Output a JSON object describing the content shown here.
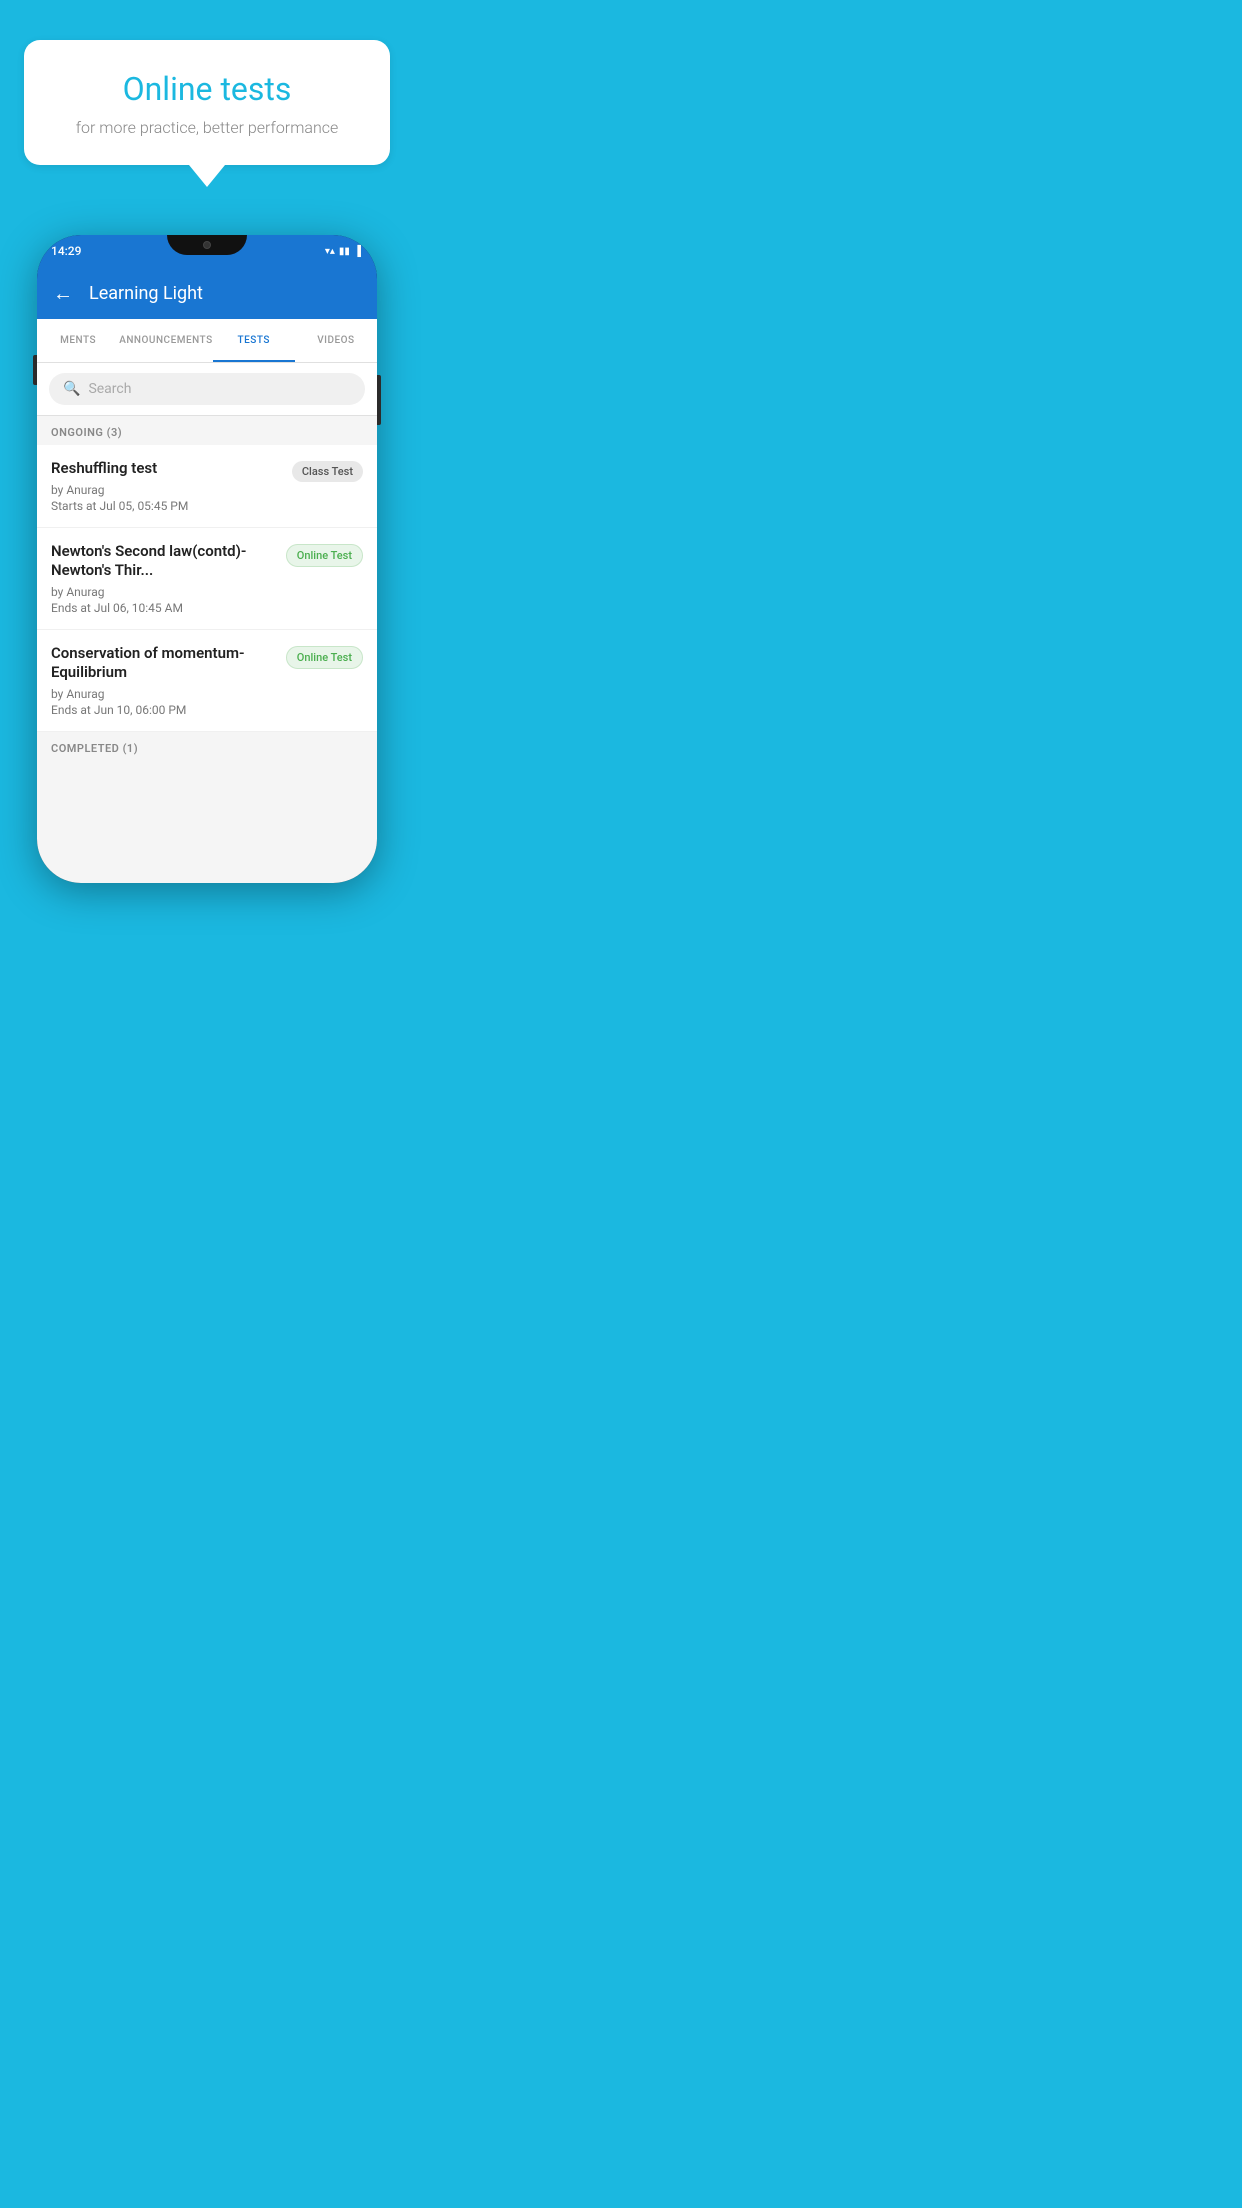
{
  "background_color": "#1bb8e0",
  "bubble": {
    "title": "Online tests",
    "subtitle": "for more practice, better performance"
  },
  "phone": {
    "status_bar": {
      "time": "14:29",
      "wifi_icon": "▼",
      "signal_icon": "▲▲",
      "battery_icon": "▐"
    },
    "app_bar": {
      "back_label": "←",
      "title": "Learning Light"
    },
    "tabs": [
      {
        "label": "MENTS",
        "active": false
      },
      {
        "label": "ANNOUNCEMENTS",
        "active": false
      },
      {
        "label": "TESTS",
        "active": true
      },
      {
        "label": "VIDEOS",
        "active": false
      }
    ],
    "search": {
      "placeholder": "Search"
    },
    "ongoing_label": "ONGOING (3)",
    "tests": [
      {
        "name": "Reshuffling test",
        "by": "by Anurag",
        "date_label": "Starts at",
        "date": "Jul 05, 05:45 PM",
        "badge": "Class Test",
        "badge_type": "class"
      },
      {
        "name": "Newton's Second law(contd)-Newton's Thir...",
        "by": "by Anurag",
        "date_label": "Ends at",
        "date": "Jul 06, 10:45 AM",
        "badge": "Online Test",
        "badge_type": "online"
      },
      {
        "name": "Conservation of momentum-Equilibrium",
        "by": "by Anurag",
        "date_label": "Ends at",
        "date": "Jun 10, 06:00 PM",
        "badge": "Online Test",
        "badge_type": "online"
      }
    ],
    "completed_label": "COMPLETED (1)"
  }
}
